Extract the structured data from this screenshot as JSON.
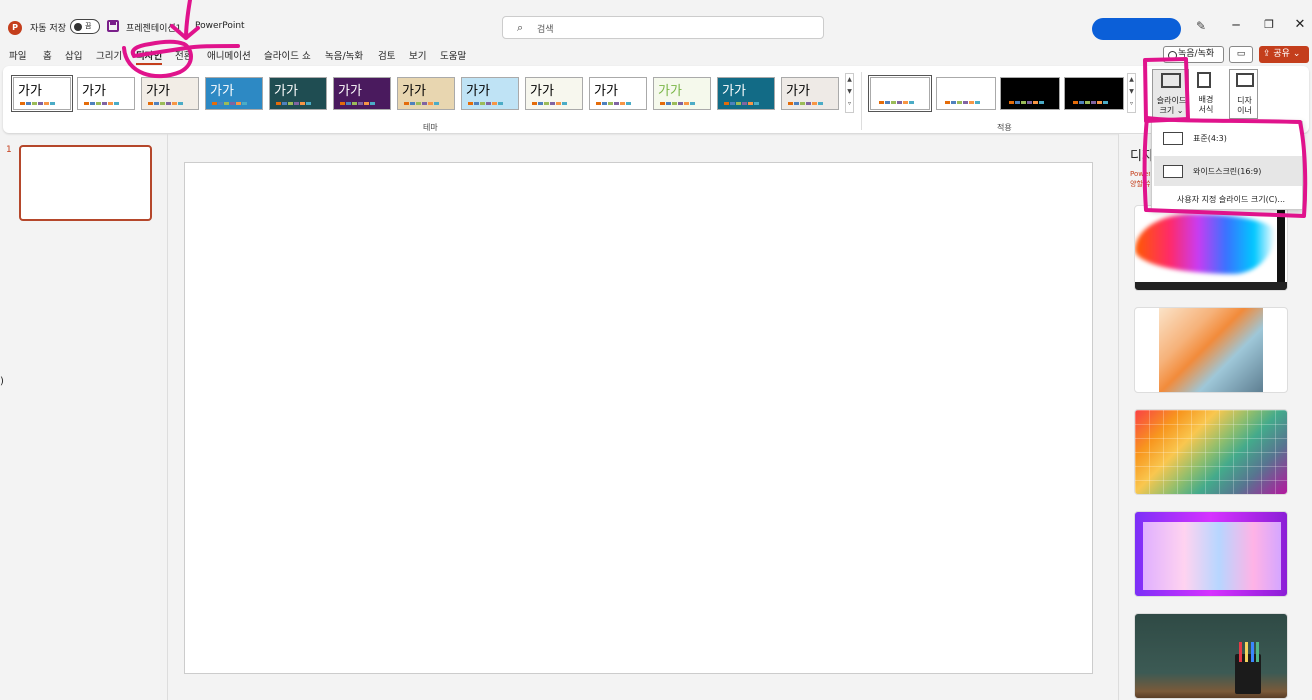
{
  "titlebar": {
    "autosave_label": "자동 저장",
    "autosave_state": "끔",
    "doc_name": "프레젠테이션1",
    "app_name": "PowerPoint",
    "search_placeholder": "검색",
    "min": "─",
    "max": "❐",
    "close": "✕",
    "pen": "✎"
  },
  "tabs": [
    {
      "label": "파일",
      "active": false
    },
    {
      "label": "홈",
      "active": false
    },
    {
      "label": "삽입",
      "active": false
    },
    {
      "label": "그리기",
      "active": false
    },
    {
      "label": "디자인",
      "active": true
    },
    {
      "label": "전환",
      "active": false
    },
    {
      "label": "애니메이션",
      "active": false
    },
    {
      "label": "슬라이드 쇼",
      "active": false
    },
    {
      "label": "녹음/녹화",
      "active": false
    },
    {
      "label": "검토",
      "active": false
    },
    {
      "label": "보기",
      "active": false
    },
    {
      "label": "도움말",
      "active": false
    }
  ],
  "right_buttons": {
    "record": "녹음/녹화",
    "comment": "▭",
    "share": "⇪ 공유 ⌄"
  },
  "ribbon": {
    "themes_group_label": "테마",
    "variants_group_label": "적용",
    "theme_text": "가가",
    "slide_size_label": "슬라이드\n크기 ⌄",
    "format_bg_label": "배경\n서식",
    "designer_label": "디자\n이너",
    "themes": [
      {
        "bg": "#ffffff",
        "fg": "#000000"
      },
      {
        "bg": "#ffffff",
        "fg": "#000000"
      },
      {
        "bg": "#f2ede6",
        "fg": "#000000"
      },
      {
        "bg": "#2d89c4",
        "fg": "#ffffff"
      },
      {
        "bg": "#1f4d52",
        "fg": "#ffffff"
      },
      {
        "bg": "#4a1a5e",
        "fg": "#ffffff"
      },
      {
        "bg": "#e8d6b0",
        "fg": "#000000"
      },
      {
        "bg": "#bfe3f5",
        "fg": "#000000"
      },
      {
        "bg": "#f7f7ee",
        "fg": "#000000"
      },
      {
        "bg": "#ffffff",
        "fg": "#000000"
      },
      {
        "bg": "#f5f9ec",
        "fg": "#7ab648"
      },
      {
        "bg": "#126b86",
        "fg": "#ffffff"
      },
      {
        "bg": "#eeeae6",
        "fg": "#000000"
      }
    ],
    "variants": [
      {
        "bg": "#ffffff"
      },
      {
        "bg": "#ffffff"
      },
      {
        "bg": "#000000"
      },
      {
        "bg": "#000000"
      }
    ],
    "dot_colors": [
      "#e46c0a",
      "#4f81bd",
      "#9bbb59",
      "#8064a2",
      "#f79646",
      "#4bacc6"
    ]
  },
  "dropdown": {
    "items": [
      {
        "label": "표준(4:3)"
      },
      {
        "label": "와이드스크린(16:9)"
      }
    ],
    "custom_label": "사용자 지정 슬라이드 크기(C)..."
  },
  "slides_panel": {
    "number": "1"
  },
  "designer": {
    "title": "디자",
    "note": "Power\n양할 수"
  },
  "colors": {
    "accent": "#c43e1c",
    "annotation": "#e0138c",
    "account": "#0b5fd8"
  },
  "misc": {
    "left_mark": ")"
  }
}
